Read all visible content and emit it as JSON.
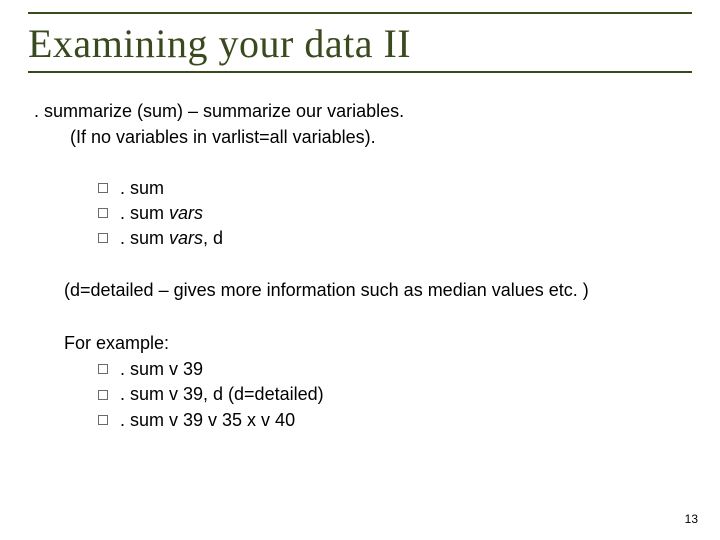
{
  "title": "Examining your data II",
  "lead_prefix": ". summarize (sum) ",
  "lead_dash": "– ",
  "lead_rest": "summarize our variables.",
  "lead_sub": "(If no variables in varlist=all variables).",
  "b1": ". sum",
  "b2a": ". sum ",
  "b2b": "vars",
  "b3a": ". sum ",
  "b3b": "vars",
  "b3c": ", d",
  "note": "(d=detailed – gives more information such as median values etc. )",
  "for_example": "For example:",
  "e1": ". sum v 39",
  "e2": ". sum v 39, d (d=detailed)",
  "e3": ". sum v 39 v 35 x v 40",
  "page_number": "13"
}
